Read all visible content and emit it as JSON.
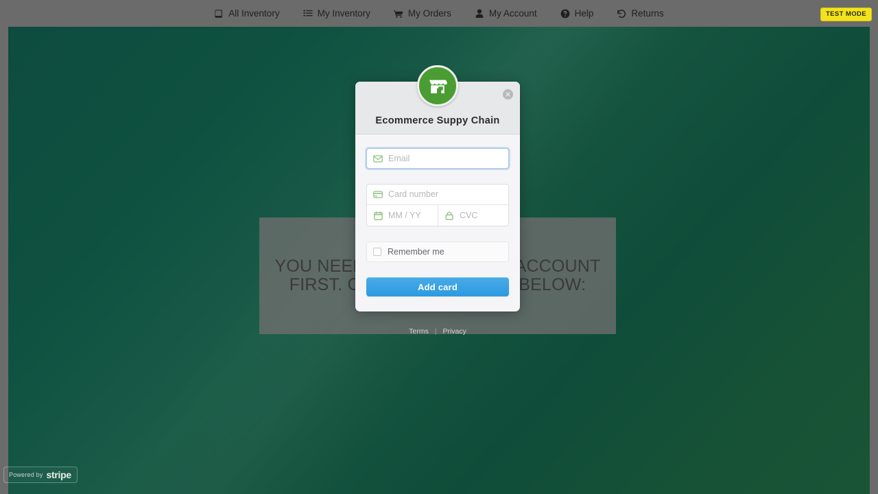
{
  "topnav": {
    "items": [
      {
        "label": "All Inventory",
        "icon": "book-icon"
      },
      {
        "label": "My Inventory",
        "icon": "list-icon"
      },
      {
        "label": "My Orders",
        "icon": "shopping-cart-icon"
      },
      {
        "label": "My Account",
        "icon": "user-icon"
      },
      {
        "label": "Help",
        "icon": "question-circle-icon"
      },
      {
        "label": "Returns",
        "icon": "undo-arrow-icon"
      }
    ],
    "test_mode_badge": "TEST MODE"
  },
  "background": {
    "message": "YOU NEED TO SETUP YOUR ACCOUNT FIRST. CLICK THE BUTTON BELOW:",
    "overlay_color": "#10503f"
  },
  "modal": {
    "title": "Ecommerce Suppy Chain",
    "logo_icon": "storefront-icon",
    "close_icon": "close-circle-icon",
    "fields": {
      "email": {
        "placeholder": "Email",
        "value": "",
        "icon": "envelope-icon",
        "focused": true
      },
      "card_number": {
        "placeholder": "Card number",
        "value": "",
        "icon": "credit-card-icon"
      },
      "expiry": {
        "placeholder": "MM / YY",
        "value": "",
        "icon": "calendar-icon"
      },
      "cvc": {
        "placeholder": "CVC",
        "value": "",
        "icon": "lock-icon"
      }
    },
    "remember_me": {
      "label": "Remember me",
      "checked": false
    },
    "submit_label": "Add card",
    "submit_color": "#36a0e3",
    "footer": {
      "terms": "Terms",
      "separator": "|",
      "privacy": "Privacy"
    }
  },
  "powered_by": {
    "prefix": "Powered by",
    "brand": "stripe"
  }
}
